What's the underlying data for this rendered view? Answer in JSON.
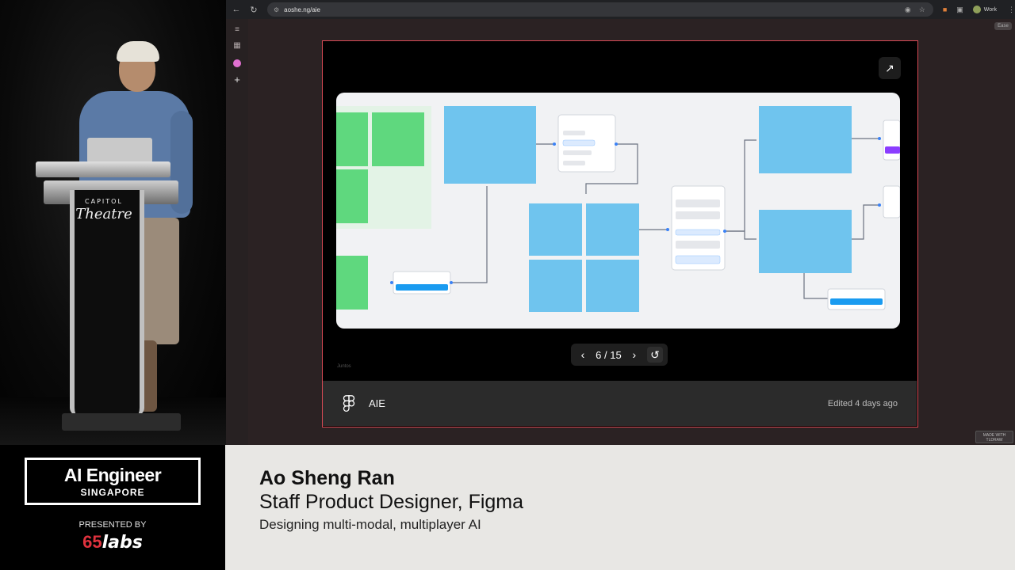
{
  "browser": {
    "url": "aoshe.ng/aie",
    "profile_label": "Work",
    "corner_chip": "Ease",
    "bottom_badge": "MADE WITH TLDRAW"
  },
  "embed": {
    "pager_text": "6 / 15",
    "file_name": "AIE",
    "edited": "Edited 4 days ago",
    "caption": "Juntos"
  },
  "event": {
    "title": "AI Engineer",
    "location": "SINGAPORE",
    "presented_by": "PRESENTED BY",
    "sponsor_num": "65",
    "sponsor_word": "labs"
  },
  "speaker": {
    "name": "Ao Sheng Ran",
    "role": "Staff Product Designer, Figma",
    "talk": "Designing multi-modal, multiplayer AI"
  },
  "podium": {
    "line1": "CAPITOL",
    "line2": "Theatre"
  },
  "colors": {
    "card_border": "#d94a55",
    "sticky_blue": "#6fc4ee",
    "sticky_green": "#5fd87e",
    "sponsor_red": "#e0323e"
  }
}
